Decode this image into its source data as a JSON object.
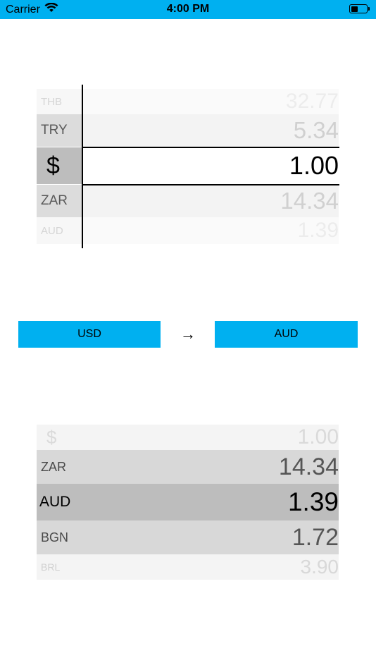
{
  "status_bar": {
    "carrier": "Carrier",
    "time": "4:00 PM",
    "wifi_icon": "wifi-icon",
    "battery_icon": "battery-icon",
    "battery_level": 0.45
  },
  "top_picker": {
    "rows": [
      {
        "code": "THB",
        "value": "32.77"
      },
      {
        "code": "TRY",
        "value": "5.34"
      },
      {
        "code": "$",
        "value": "1.00"
      },
      {
        "code": "ZAR",
        "value": "14.34"
      },
      {
        "code": "AUD",
        "value": "1.39"
      }
    ],
    "selected_index": 2
  },
  "converter": {
    "from_label": "USD",
    "arrow": "→",
    "to_label": "AUD",
    "accent_color": "#00b0f0"
  },
  "bottom_picker": {
    "rows": [
      {
        "code": "$",
        "value": "1.00"
      },
      {
        "code": "ZAR",
        "value": "14.34"
      },
      {
        "code": "AUD",
        "value": "1.39"
      },
      {
        "code": "BGN",
        "value": "1.72"
      },
      {
        "code": "BRL",
        "value": "3.90"
      }
    ],
    "selected_index": 2
  }
}
